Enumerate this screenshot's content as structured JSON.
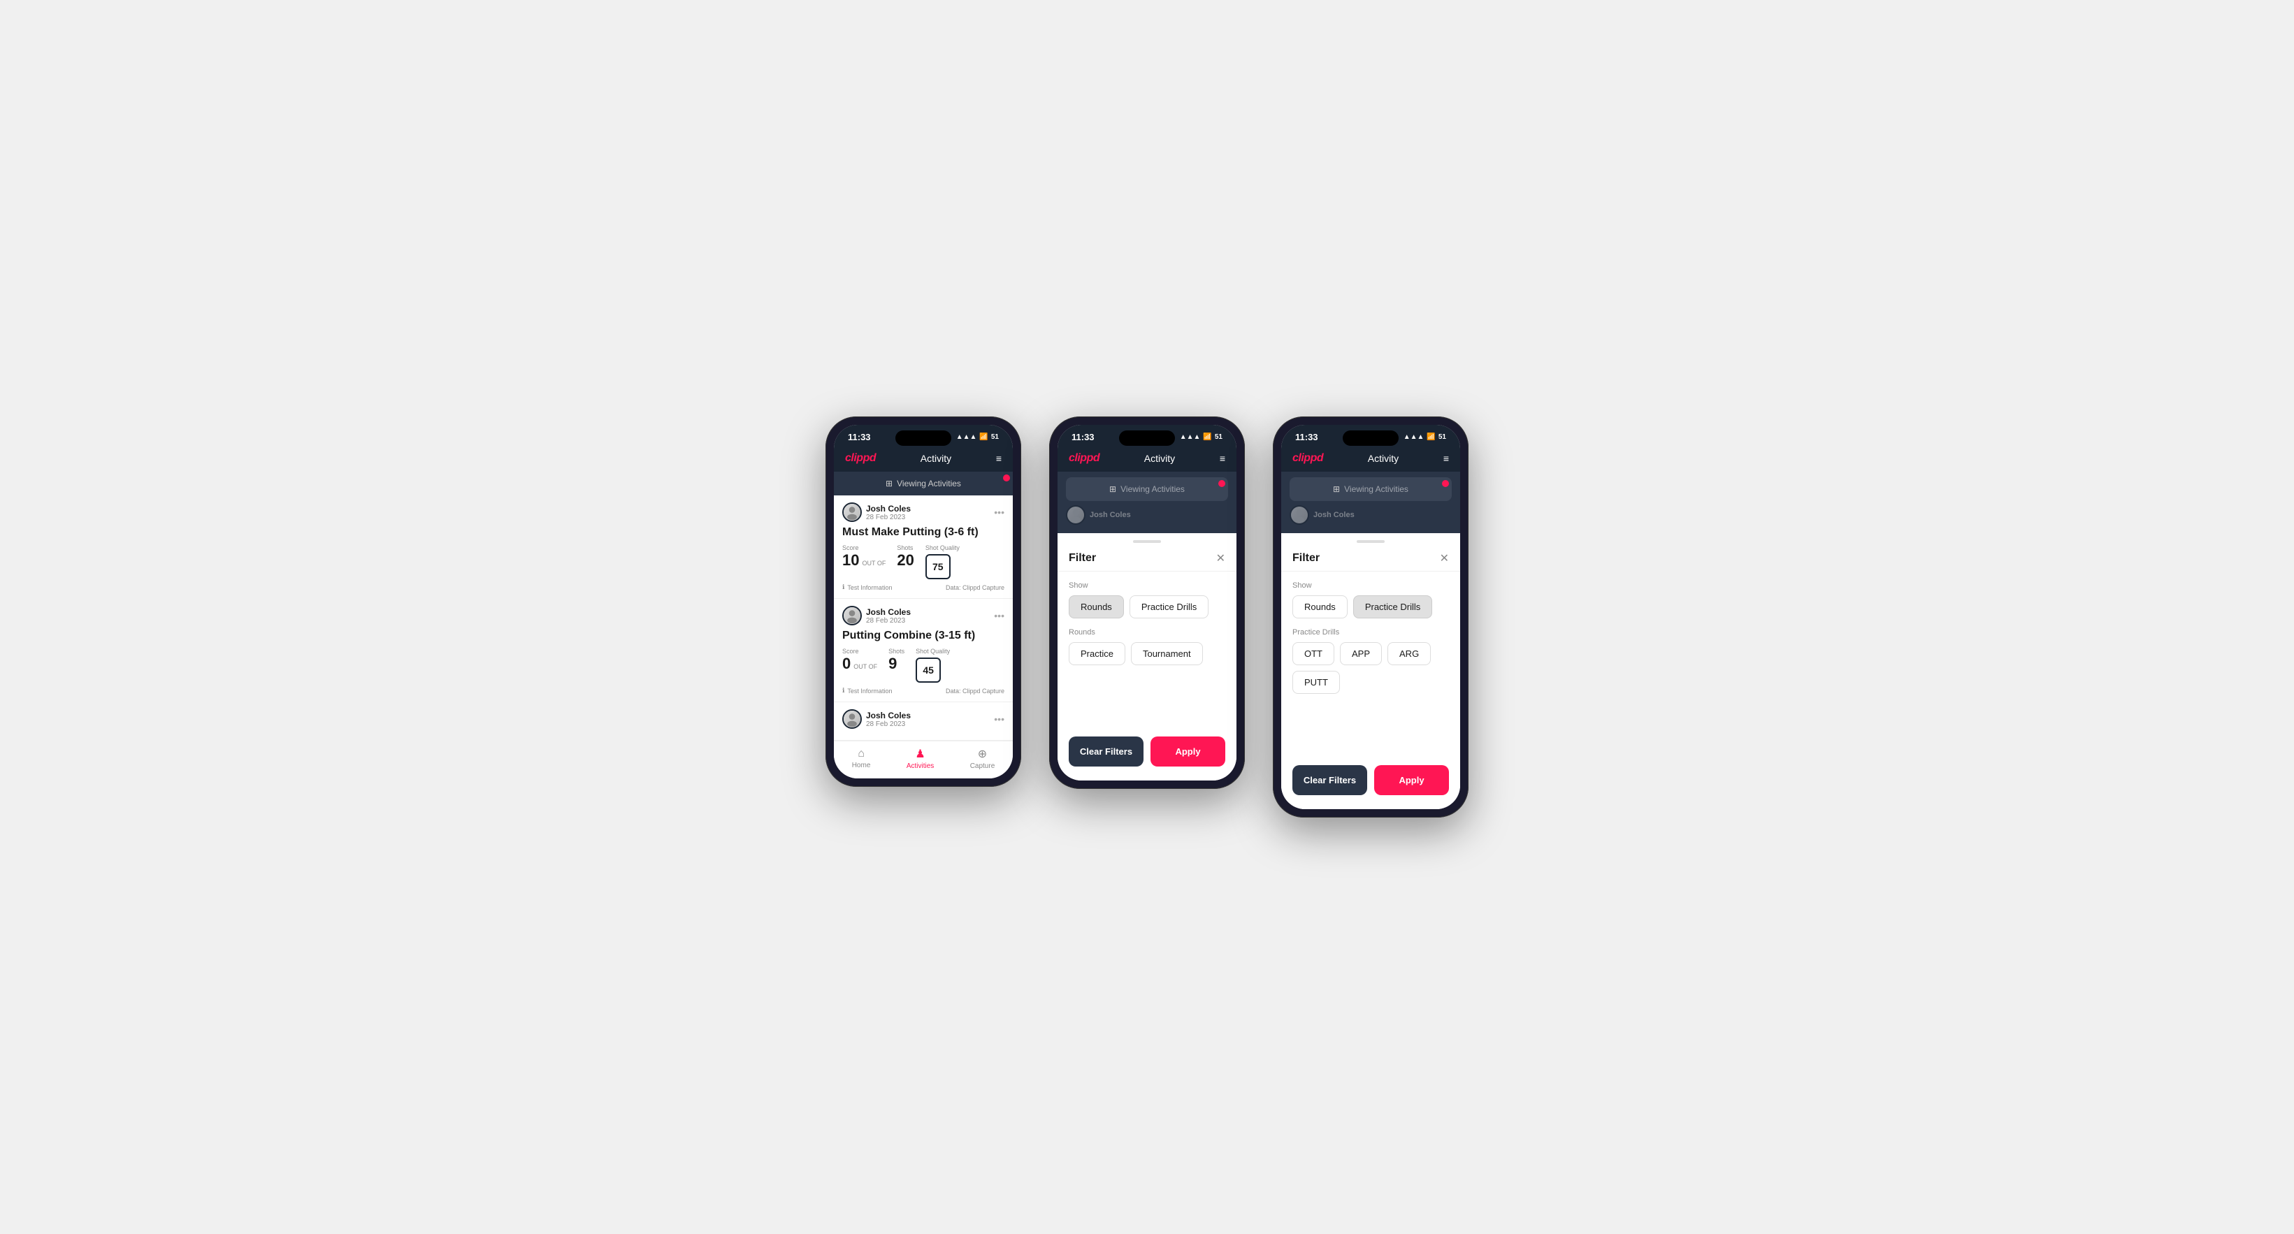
{
  "app": {
    "logo": "clippd",
    "nav_title": "Activity",
    "hamburger": "≡",
    "time": "11:33"
  },
  "status": {
    "signal": "▲▲▲",
    "wifi": "WiFi",
    "battery": "51"
  },
  "viewing_banner": {
    "label": "Viewing Activities"
  },
  "cards": [
    {
      "user_name": "Josh Coles",
      "user_date": "28 Feb 2023",
      "title": "Must Make Putting (3-6 ft)",
      "score_label": "Score",
      "score_value": "10",
      "out_of_label": "OUT OF",
      "shots_label": "Shots",
      "shots_value": "20",
      "shot_quality_label": "Shot Quality",
      "shot_quality_value": "75",
      "test_info": "Test Information",
      "data_info": "Data: Clippd Capture"
    },
    {
      "user_name": "Josh Coles",
      "user_date": "28 Feb 2023",
      "title": "Putting Combine (3-15 ft)",
      "score_label": "Score",
      "score_value": "0",
      "out_of_label": "OUT OF",
      "shots_label": "Shots",
      "shots_value": "9",
      "shot_quality_label": "Shot Quality",
      "shot_quality_value": "45",
      "test_info": "Test Information",
      "data_info": "Data: Clippd Capture"
    },
    {
      "user_name": "Josh Coles",
      "user_date": "28 Feb 2023",
      "title": "",
      "score_label": "",
      "score_value": "",
      "out_of_label": "",
      "shots_label": "",
      "shots_value": "",
      "shot_quality_label": "",
      "shot_quality_value": "",
      "test_info": "",
      "data_info": ""
    }
  ],
  "bottom_nav": [
    {
      "label": "Home",
      "icon": "⌂",
      "active": false
    },
    {
      "label": "Activities",
      "icon": "♟",
      "active": true
    },
    {
      "label": "Capture",
      "icon": "⊕",
      "active": false
    }
  ],
  "filter_phone2": {
    "title": "Filter",
    "show_label": "Show",
    "show_buttons": [
      {
        "label": "Rounds",
        "active": true
      },
      {
        "label": "Practice Drills",
        "active": false
      }
    ],
    "rounds_label": "Rounds",
    "rounds_buttons": [
      {
        "label": "Practice",
        "active": false
      },
      {
        "label": "Tournament",
        "active": false
      }
    ],
    "clear_label": "Clear Filters",
    "apply_label": "Apply"
  },
  "filter_phone3": {
    "title": "Filter",
    "show_label": "Show",
    "show_buttons": [
      {
        "label": "Rounds",
        "active": false
      },
      {
        "label": "Practice Drills",
        "active": true
      }
    ],
    "drills_label": "Practice Drills",
    "drills_buttons": [
      {
        "label": "OTT",
        "active": false
      },
      {
        "label": "APP",
        "active": false
      },
      {
        "label": "ARG",
        "active": false
      },
      {
        "label": "PUTT",
        "active": false
      }
    ],
    "clear_label": "Clear Filters",
    "apply_label": "Apply"
  }
}
